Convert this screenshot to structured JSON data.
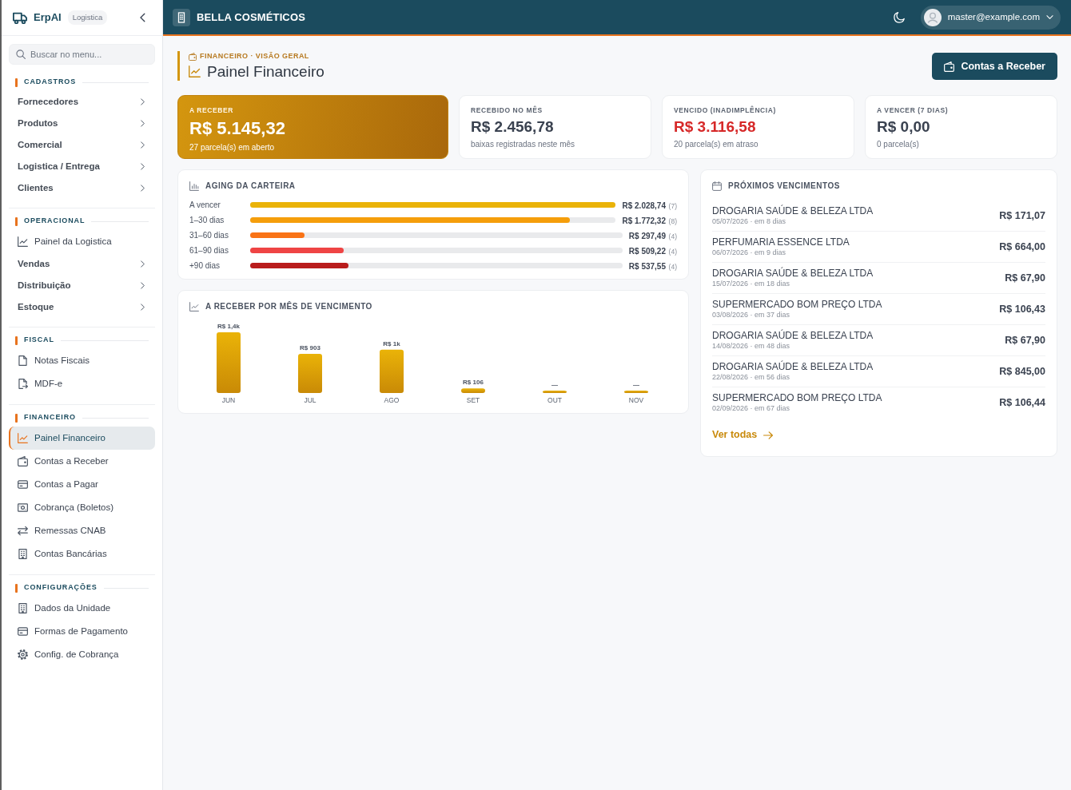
{
  "sidebar": {
    "brand": {
      "name": "ErpAI",
      "badge": "Logistica"
    },
    "search": {
      "placeholder": "Buscar no menu..."
    },
    "sections": [
      {
        "title": "CADASTROS",
        "items": [
          {
            "label": "Fornecedores",
            "kind": "group",
            "selected": false
          },
          {
            "label": "Produtos",
            "kind": "group",
            "selected": false
          },
          {
            "label": "Comercial",
            "kind": "group",
            "selected": false
          },
          {
            "label": "Logistica / Entrega",
            "kind": "group",
            "selected": false
          },
          {
            "label": "Clientes",
            "kind": "group",
            "selected": false
          }
        ]
      },
      {
        "title": "OPERACIONAL",
        "items": [
          {
            "label": "Painel da Logistica",
            "kind": "link",
            "selected": false
          },
          {
            "label": "Vendas",
            "kind": "group",
            "selected": false
          },
          {
            "label": "Distribuição",
            "kind": "group",
            "selected": false
          },
          {
            "label": "Estoque",
            "kind": "group",
            "selected": false
          }
        ]
      },
      {
        "title": "FISCAL",
        "items": [
          {
            "label": "Notas Fiscais",
            "kind": "link",
            "selected": false
          },
          {
            "label": "MDF-e",
            "kind": "link",
            "selected": false
          }
        ]
      },
      {
        "title": "FINANCEIRO",
        "items": [
          {
            "label": "Painel Financeiro",
            "kind": "link",
            "selected": true
          },
          {
            "label": "Contas a Receber",
            "kind": "link",
            "selected": false
          },
          {
            "label": "Contas a Pagar",
            "kind": "link",
            "selected": false
          },
          {
            "label": "Cobrança (Boletos)",
            "kind": "link",
            "selected": false
          },
          {
            "label": "Remessas CNAB",
            "kind": "link",
            "selected": false
          },
          {
            "label": "Contas Bancárias",
            "kind": "link",
            "selected": false
          }
        ]
      },
      {
        "title": "CONFIGURAÇÕES",
        "items": [
          {
            "label": "Dados da Unidade",
            "kind": "link",
            "selected": false
          },
          {
            "label": "Formas de Pagamento",
            "kind": "link",
            "selected": false
          },
          {
            "label": "Config. de Cobrança",
            "kind": "link",
            "selected": false
          }
        ]
      }
    ]
  },
  "top_bar": {
    "company": "BELLA COSMÉTICOS",
    "user": "master@example.com"
  },
  "page_header": {
    "breadcrumb": "FINANCEIRO · VISÃO GERAL",
    "title": "Painel Financeiro",
    "action_button": "Contas a Receber"
  },
  "kpis": [
    {
      "label": "A RECEBER",
      "value": "R$ 5.145,32",
      "note": "27 parcela(s) em aberto",
      "kind": "highlight"
    },
    {
      "label": "RECEBIDO NO MÊS",
      "value": "R$ 2.456,78",
      "note": "baixas registradas neste mês",
      "kind": "normal"
    },
    {
      "label": "VENCIDO (INADIMPLÊNCIA)",
      "value": "R$ 3.116,58",
      "note": "20 parcela(s) em atraso",
      "kind": "danger"
    },
    {
      "label": "A VENCER (7 DIAS)",
      "value": "R$ 0,00",
      "note": "0 parcela(s)",
      "kind": "normal"
    }
  ],
  "aging": {
    "title": "AGING DA CARTEIRA",
    "rows": [
      {
        "label": "A vencer",
        "amount": "R$ 2.028,74",
        "count": "(7)",
        "level": 1.0,
        "color": "#eab308"
      },
      {
        "label": "1–30 dias",
        "amount": "R$ 1.772,32",
        "count": "(8)",
        "level": 0.874,
        "color": "#f59e0b"
      },
      {
        "label": "31–60 dias",
        "amount": "R$ 297,49",
        "count": "(4)",
        "level": 0.147,
        "color": "#f97316"
      },
      {
        "label": "61–90 dias",
        "amount": "R$ 509,22",
        "count": "(4)",
        "level": 0.251,
        "color": "#ef4444"
      },
      {
        "label": "+90 dias",
        "amount": "R$ 537,55",
        "count": "(4)",
        "level": 0.265,
        "color": "#b91c1c"
      }
    ]
  },
  "monthly": {
    "chart_data": {
      "type": "bar",
      "title": "A RECEBER POR MÊS DE VENCIMENTO",
      "categories": [
        "JUN",
        "JUL",
        "AGO",
        "SET",
        "OUT",
        "NOV"
      ],
      "values": [
        1400,
        903,
        1000,
        106,
        0,
        0
      ],
      "value_labels": [
        "R$ 1,4k",
        "R$ 903",
        "R$ 1k",
        "R$ 106",
        "—",
        "—"
      ]
    }
  },
  "upcoming": {
    "title": "PRÓXIMOS VENCIMENTOS",
    "items": [
      {
        "name": "DROGARIA SAÚDE & BELEZA LTDA",
        "meta": "05/07/2026 · em 8 dias",
        "amount": "R$ 171,07"
      },
      {
        "name": "PERFUMARIA ESSENCE LTDA",
        "meta": "06/07/2026 · em 9 dias",
        "amount": "R$ 664,00"
      },
      {
        "name": "DROGARIA SAÚDE & BELEZA LTDA",
        "meta": "15/07/2026 · em 18 dias",
        "amount": "R$ 67,90"
      },
      {
        "name": "SUPERMERCADO BOM PREÇO LTDA",
        "meta": "03/08/2026 · em 37 dias",
        "amount": "R$ 106,43"
      },
      {
        "name": "DROGARIA SAÚDE & BELEZA LTDA",
        "meta": "14/08/2026 · em 48 dias",
        "amount": "R$ 67,90"
      },
      {
        "name": "DROGARIA SAÚDE & BELEZA LTDA",
        "meta": "22/08/2026 · em 56 dias",
        "amount": "R$ 845,00"
      },
      {
        "name": "SUPERMERCADO BOM PREÇO LTDA",
        "meta": "02/09/2026 · em 67 dias",
        "amount": "R$ 106,44"
      }
    ],
    "link": "Ver todas"
  }
}
